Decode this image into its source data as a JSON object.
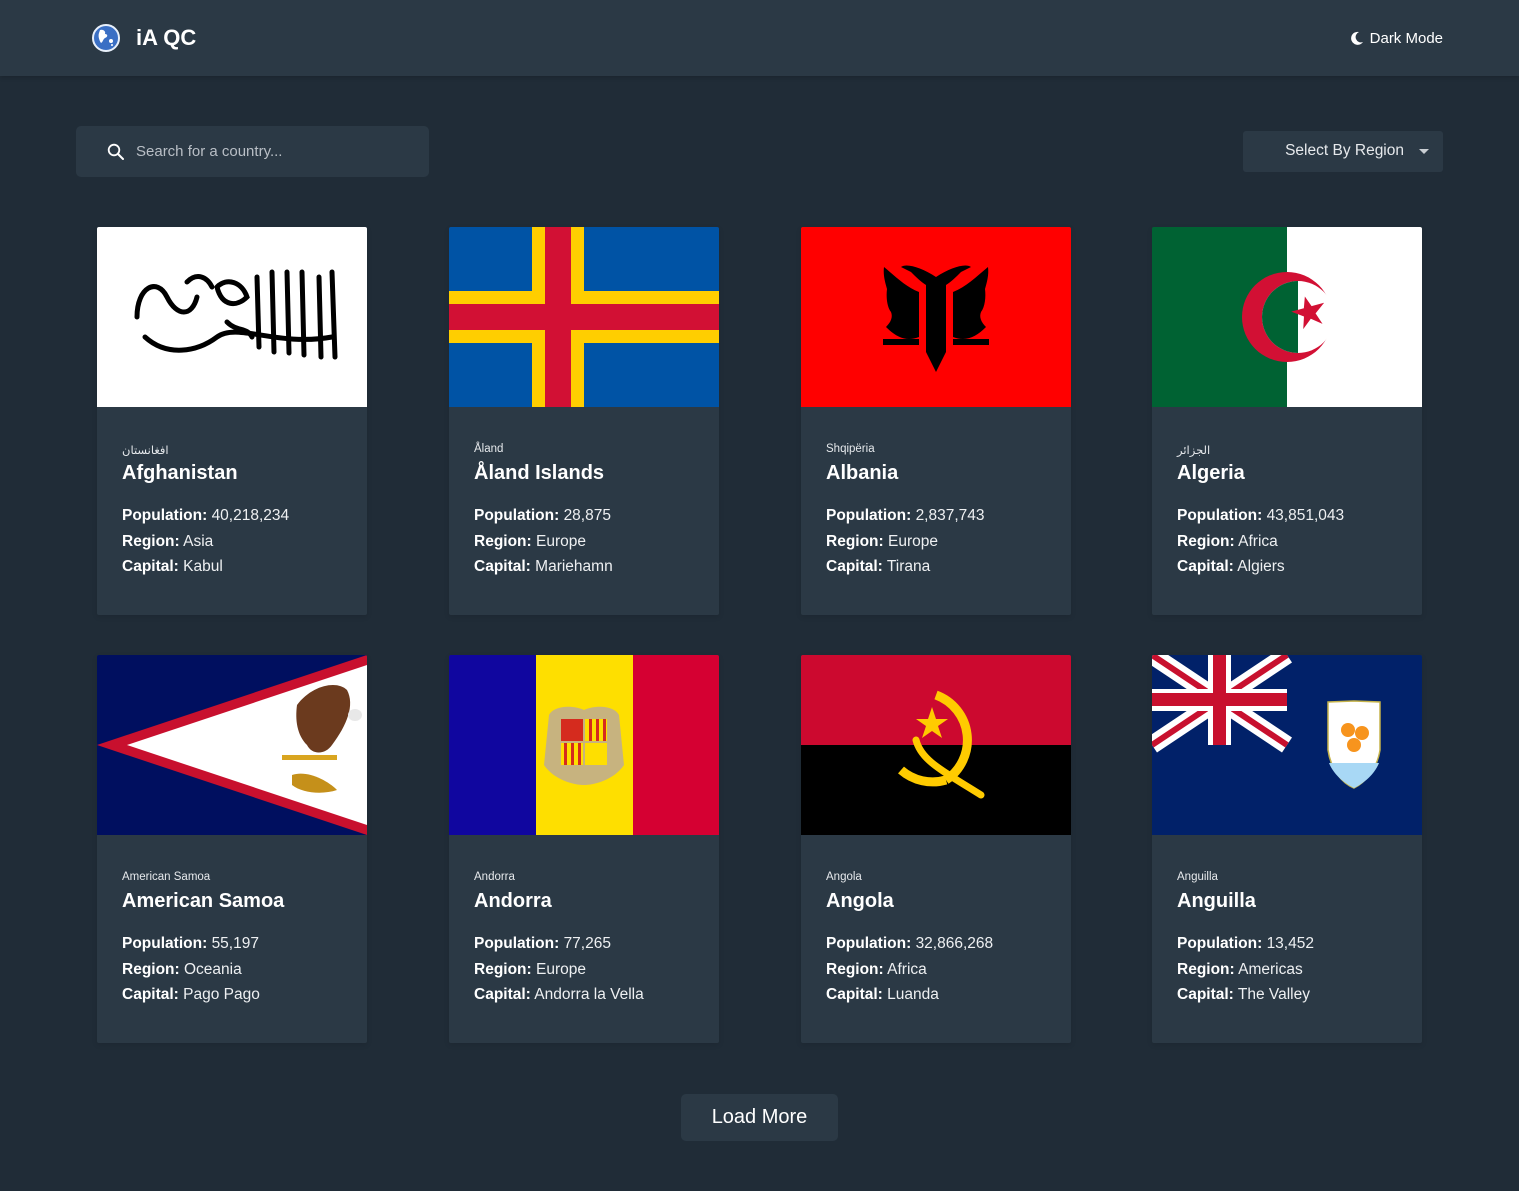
{
  "header": {
    "brand": "iA QC",
    "logo_icon": "globe-icon",
    "mode_icon": "moon-icon",
    "mode_label": "Dark Mode"
  },
  "search": {
    "icon": "search-icon",
    "placeholder": "Search for a country...",
    "value": ""
  },
  "filter": {
    "label": "Select By Region",
    "icon": "caret-down-icon"
  },
  "labels": {
    "population": "Population:",
    "region": "Region:",
    "capital": "Capital:"
  },
  "countries": [
    {
      "native": "افغانستان",
      "name": "Afghanistan",
      "population": "40,218,234",
      "region": "Asia",
      "capital": "Kabul",
      "flag": "afghanistan"
    },
    {
      "native": "Åland",
      "name": "Åland Islands",
      "population": "28,875",
      "region": "Europe",
      "capital": "Mariehamn",
      "flag": "aland"
    },
    {
      "native": "Shqipëria",
      "name": "Albania",
      "population": "2,837,743",
      "region": "Europe",
      "capital": "Tirana",
      "flag": "albania"
    },
    {
      "native": "الجزائر",
      "name": "Algeria",
      "population": "43,851,043",
      "region": "Africa",
      "capital": "Algiers",
      "flag": "algeria"
    },
    {
      "native": "American Samoa",
      "name": "American Samoa",
      "population": "55,197",
      "region": "Oceania",
      "capital": "Pago Pago",
      "flag": "american-samoa"
    },
    {
      "native": "Andorra",
      "name": "Andorra",
      "population": "77,265",
      "region": "Europe",
      "capital": "Andorra la Vella",
      "flag": "andorra"
    },
    {
      "native": "Angola",
      "name": "Angola",
      "population": "32,866,268",
      "region": "Africa",
      "capital": "Luanda",
      "flag": "angola"
    },
    {
      "native": "Anguilla",
      "name": "Anguilla",
      "population": "13,452",
      "region": "Americas",
      "capital": "The Valley",
      "flag": "anguilla"
    }
  ],
  "load_more": {
    "label": "Load More"
  },
  "colors": {
    "background": "#202c37",
    "surface": "#2b3945",
    "text": "#ffffff"
  }
}
